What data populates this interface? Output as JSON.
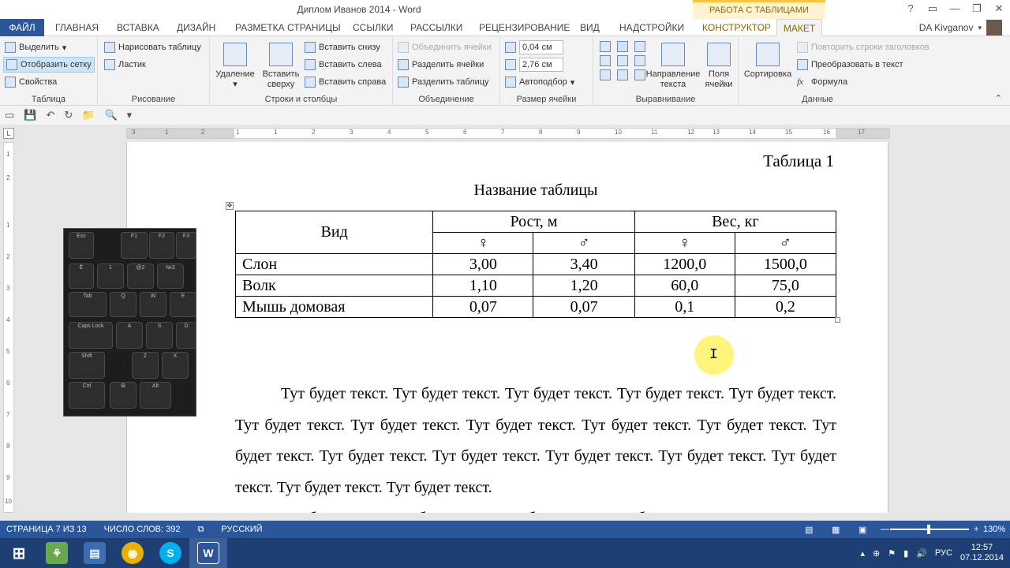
{
  "window": {
    "title": "Диплом Иванов 2014 - Word",
    "context_group": "РАБОТА С ТАБЛИЦАМИ",
    "controls": [
      "?",
      "▭",
      "—",
      "❐",
      "✕"
    ]
  },
  "tabs": [
    {
      "label": "ФАЙЛ"
    },
    {
      "label": "ГЛАВНАЯ"
    },
    {
      "label": "ВСТАВКА"
    },
    {
      "label": "ДИЗАЙН"
    },
    {
      "label": "РАЗМЕТКА СТРАНИЦЫ"
    },
    {
      "label": "ССЫЛКИ"
    },
    {
      "label": "РАССЫЛКИ"
    },
    {
      "label": "РЕЦЕНЗИРОВАНИЕ"
    },
    {
      "label": "ВИД"
    },
    {
      "label": "НАДСТРОЙКИ"
    },
    {
      "label": "КОНСТРУКТОР"
    },
    {
      "label": "МАКЕТ"
    }
  ],
  "user": {
    "name": "DA Kivganov"
  },
  "ribbon": {
    "table": {
      "label": "Таблица",
      "select": "Выделить",
      "grid": "Отобразить сетку",
      "props": "Свойства"
    },
    "draw": {
      "label": "Рисование",
      "draw_table": "Нарисовать таблицу",
      "eraser": "Ластик"
    },
    "rows": {
      "label": "Строки и столбцы",
      "delete": "Удаление",
      "insert_above": "Вставить сверху",
      "insert_below": "Вставить снизу",
      "insert_left": "Вставить слева",
      "insert_right": "Вставить справа"
    },
    "merge": {
      "label": "Объединение",
      "merge_cells": "Объединить ячейки",
      "split_cells": "Разделить ячейки",
      "split_table": "Разделить таблицу"
    },
    "size": {
      "label": "Размер ячейки",
      "height": "0,04 см",
      "width": "2,76 см",
      "autofit": "Автоподбор"
    },
    "align": {
      "label": "Выравнивание",
      "direction": "Направление текста",
      "margins": "Поля ячейки"
    },
    "data": {
      "label": "Данные",
      "sort": "Сортировка",
      "repeat_header": "Повторить строки заголовков",
      "convert": "Преобразовать в текст",
      "formula": "Формула"
    }
  },
  "ruler": {
    "h_ticks": [
      "3",
      "1",
      "2",
      "1",
      "1",
      "2",
      "3",
      "4",
      "5",
      "6",
      "7",
      "8",
      "9",
      "10",
      "11",
      "12",
      "13",
      "14",
      "15",
      "16",
      "17"
    ],
    "v_ticks": [
      "1",
      "2",
      "1",
      "2",
      "3",
      "4",
      "5",
      "6",
      "7",
      "8",
      "9",
      "10"
    ]
  },
  "document": {
    "caption": "Таблица 1",
    "table_title": "Название таблицы",
    "table": {
      "h_type": "Вид",
      "h_height": "Рост, м",
      "h_weight": "Вес, кг",
      "female": "♀",
      "male": "♂",
      "rows": [
        {
          "name": "Слон",
          "hf": "3,00",
          "hm": "3,40",
          "wf": "1200,0",
          "wm": "1500,0"
        },
        {
          "name": "Волк",
          "hf": "1,10",
          "hm": "1,20",
          "wf": "60,0",
          "wm": "75,0"
        },
        {
          "name": "Мышь домовая",
          "hf": "0,07",
          "hm": "0,07",
          "wf": "0,1",
          "wm": "0,2"
        }
      ]
    },
    "paragraph1": "Тут будет текст. Тут будет текст. Тут будет текст. Тут будет текст. Тут будет текст. Тут будет текст. Тут будет текст. Тут будет текст. Тут будет текст. Тут будет текст. Тут будет текст. Тут будет текст. Тут будет текст. Тут будет текст. Тут будет текст. Тут будет текст. Тут будет текст. Тут будет текст.",
    "paragraph2": "Тут будет текст. Тут будет текст. Тут будет текст. Тут будет текст. Тут",
    "photo_keys": [
      "Esc",
      "F1",
      "F2",
      "F3",
      "Ё",
      "1",
      "@2",
      "№3",
      "Tab",
      "Q",
      "W",
      "E",
      "Caps Lock",
      "A",
      "S",
      "D",
      "Shift",
      "Z",
      "X",
      "Ctrl",
      "Alt"
    ]
  },
  "status": {
    "page": "СТРАНИЦА 7 ИЗ 13",
    "words": "ЧИСЛО СЛОВ: 392",
    "lang": "РУССКИЙ",
    "zoom_percent": "130%",
    "zoom_level": 0.47
  },
  "taskbar": {
    "lang": "РУС",
    "time": "12:57",
    "date": "07.12.2014"
  }
}
